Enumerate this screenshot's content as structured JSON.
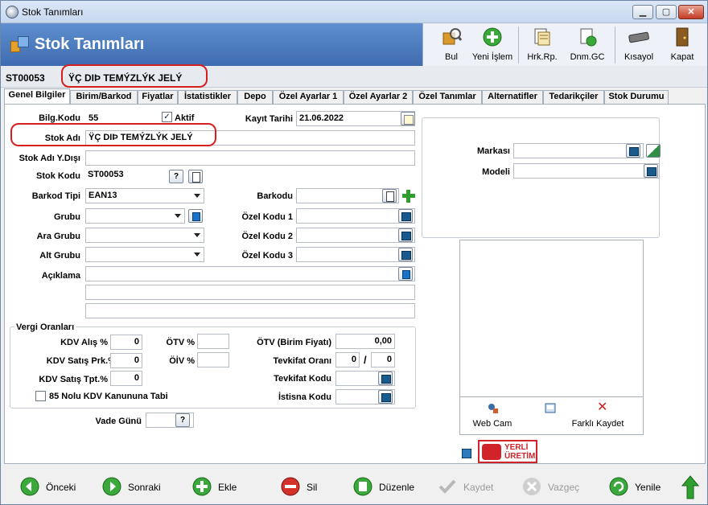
{
  "window": {
    "title": "Stok Tanımları"
  },
  "header": {
    "title": "Stok Tanımları"
  },
  "toolbar": {
    "bul": "Bul",
    "yeni": "Yeni İşlem",
    "hrk": "Hrk.Rp.",
    "dnm": "Dnm.GC",
    "kisayol": "Kısayol",
    "kapat": "Kapat"
  },
  "record": {
    "code": "ST00053",
    "name": "ŸÇ DIÞ TEMÝZLÝK JELÝ"
  },
  "tabs": [
    "Genel Bilgiler",
    "Birim/Barkod",
    "Fiyatlar",
    "İstatistikler",
    "Depo",
    "Özel Ayarlar 1",
    "Özel Ayarlar 2",
    "Özel Tanımlar",
    "Alternatifler",
    "Tedarikçiler",
    "Stok Durumu"
  ],
  "form": {
    "bilgkodu_label": "Bilg.Kodu",
    "bilgkodu": "55",
    "aktif_label": "Aktif",
    "aktif": true,
    "kayit_tarihi_label": "Kayıt Tarihi",
    "kayit_tarihi": "21.06.2022",
    "stok_adi_label": "Stok Adı",
    "stok_adi": "ŸÇ DIÞ TEMÝZLÝK JELÝ",
    "stok_adi_yd_label": "Stok Adı Y.Dışı",
    "stok_kodu_label": "Stok Kodu",
    "stok_kodu": "ST00053",
    "barkod_tipi_label": "Barkod Tipi",
    "barkod_tipi": "EAN13",
    "barkodu_label": "Barkodu",
    "grubu_label": "Grubu",
    "ara_grubu_label": "Ara Grubu",
    "alt_grubu_label": "Alt Grubu",
    "ozel1_label": "Özel Kodu 1",
    "ozel2_label": "Özel Kodu 2",
    "ozel3_label": "Özel Kodu 3",
    "aciklama_label": "Açıklama",
    "markasi_label": "Markası",
    "modeli_label": "Modeli"
  },
  "vergi": {
    "title": "Vergi Oranları",
    "kdv_alis_label": "KDV Alış %",
    "kdv_alis": "0",
    "kdv_satis_prk_label": "KDV Satış Prk.%",
    "kdv_satis_prk": "0",
    "kdv_satis_tpt_label": "KDV Satış Tpt.%",
    "kdv_satis_tpt": "0",
    "otv_label": "ÖTV %",
    "oiv_label": "ÖİV %",
    "otv_birim_label": "ÖTV (Birim Fiyatı)",
    "otv_birim": "0,00",
    "tevkifat_orani_label": "Tevkifat Oranı",
    "tevkifat_a": "0",
    "tevkifat_b": "0",
    "tevkifat_kodu_label": "Tevkifat Kodu",
    "istisna_kodu_label": "İstisna Kodu",
    "kanun_label": "85 Nolu KDV Kanununa Tabi"
  },
  "vade": {
    "label": "Vade Günü"
  },
  "image": {
    "webcam": "Web Cam",
    "farkli": "Farklı Kaydet"
  },
  "badge": {
    "line1": "YERLİ",
    "line2": "ÜRETİM"
  },
  "footer": {
    "onceki": "Önceki",
    "sonraki": "Sonraki",
    "ekle": "Ekle",
    "sil": "Sil",
    "duzenle": "Düzenle",
    "kaydet": "Kaydet",
    "vazgec": "Vazgeç",
    "yenile": "Yenile"
  },
  "colors": {
    "header": "#4a7bbf",
    "annotation": "#d62020",
    "badge": "#d0232a"
  }
}
